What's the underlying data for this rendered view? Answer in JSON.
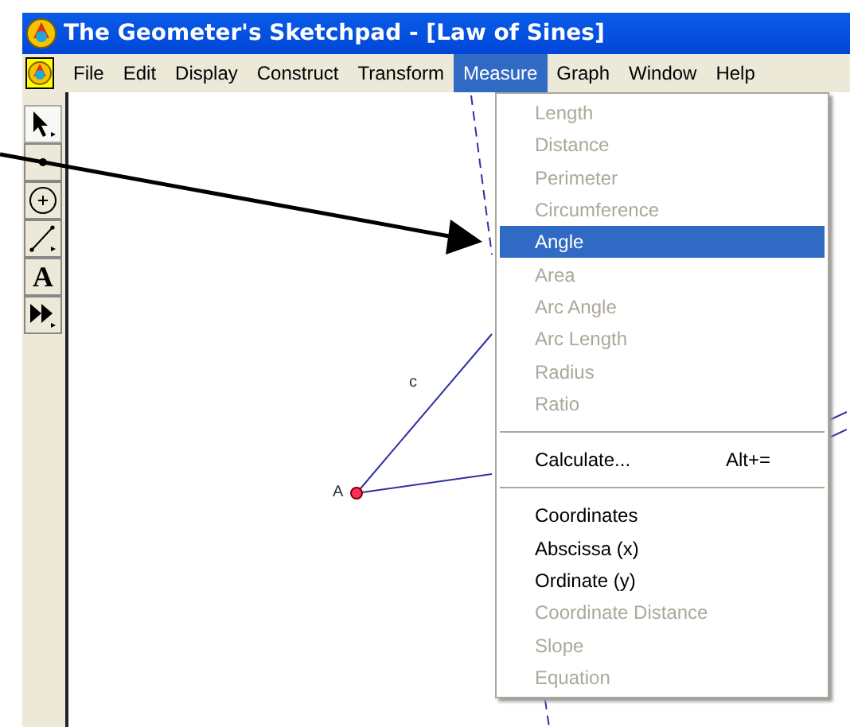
{
  "window": {
    "title": "The Geometer's Sketchpad - [Law of Sines]"
  },
  "menubar": [
    {
      "label": "File",
      "selected": false
    },
    {
      "label": "Edit",
      "selected": false
    },
    {
      "label": "Display",
      "selected": false
    },
    {
      "label": "Construct",
      "selected": false
    },
    {
      "label": "Transform",
      "selected": false
    },
    {
      "label": "Measure",
      "selected": true
    },
    {
      "label": "Graph",
      "selected": false
    },
    {
      "label": "Window",
      "selected": false
    },
    {
      "label": "Help",
      "selected": false
    }
  ],
  "toolbox": [
    {
      "kind": "arrow",
      "selected": true
    },
    {
      "kind": "point",
      "selected": false
    },
    {
      "kind": "compass",
      "selected": false
    },
    {
      "kind": "segment",
      "selected": false
    },
    {
      "kind": "text",
      "glyph": "A",
      "selected": false
    },
    {
      "kind": "custom",
      "selected": false
    }
  ],
  "canvas": {
    "labels": [
      {
        "text": "c",
        "kind": "segment"
      },
      {
        "text": "A",
        "kind": "point"
      }
    ]
  },
  "menu": {
    "groups": [
      [
        {
          "label": "Length",
          "disabled": true,
          "selected": false
        },
        {
          "label": "Distance",
          "disabled": true,
          "selected": false
        },
        {
          "label": "Perimeter",
          "disabled": true,
          "selected": false
        },
        {
          "label": "Circumference",
          "disabled": true,
          "selected": false
        },
        {
          "label": "Angle",
          "disabled": false,
          "selected": true
        },
        {
          "label": "Area",
          "disabled": true,
          "selected": false
        },
        {
          "label": "Arc Angle",
          "disabled": true,
          "selected": false
        },
        {
          "label": "Arc Length",
          "disabled": true,
          "selected": false
        },
        {
          "label": "Radius",
          "disabled": true,
          "selected": false
        },
        {
          "label": "Ratio",
          "disabled": true,
          "selected": false
        }
      ],
      [
        {
          "label": "Calculate...",
          "shortcut": "Alt+=",
          "disabled": false,
          "selected": false
        }
      ],
      [
        {
          "label": "Coordinates",
          "disabled": false,
          "selected": false
        },
        {
          "label": "Abscissa (x)",
          "disabled": false,
          "selected": false
        },
        {
          "label": "Ordinate (y)",
          "disabled": false,
          "selected": false
        },
        {
          "label": "Coordinate Distance",
          "disabled": true,
          "selected": false
        },
        {
          "label": "Slope",
          "disabled": true,
          "selected": false
        },
        {
          "label": "Equation",
          "disabled": true,
          "selected": false
        }
      ]
    ]
  }
}
